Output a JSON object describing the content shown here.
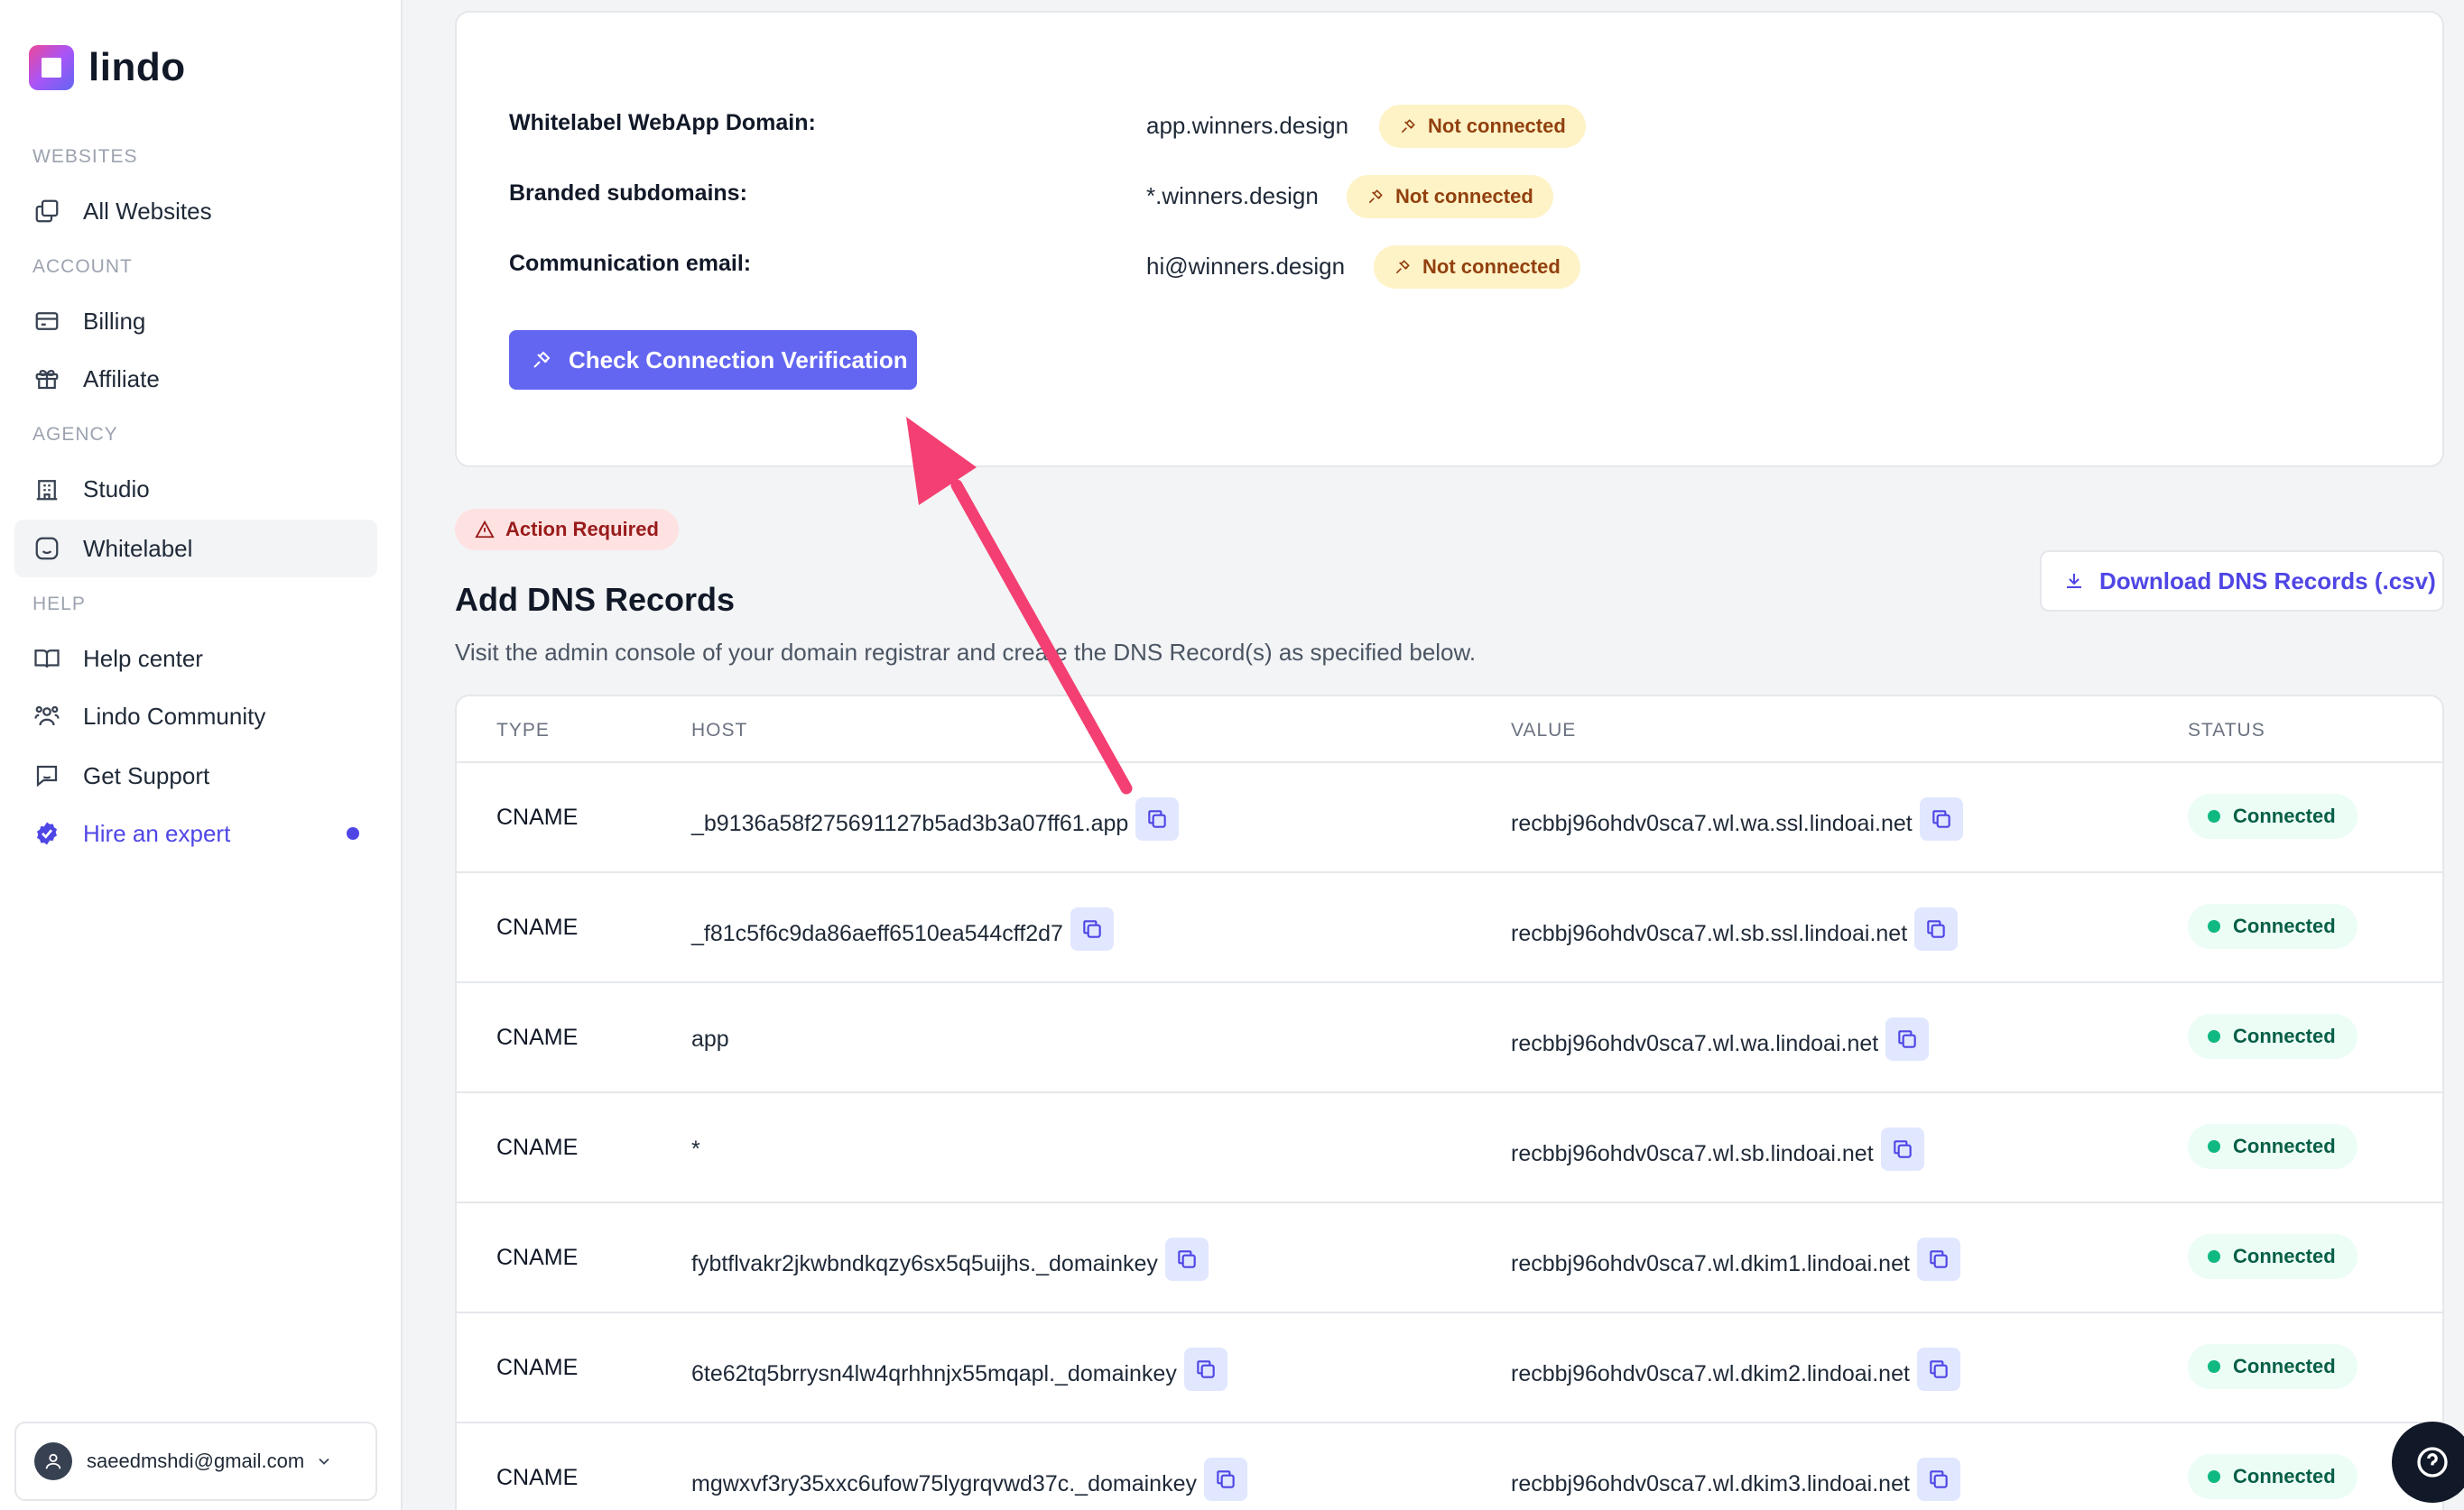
{
  "app": {
    "name": "lindo"
  },
  "sidebar": {
    "sections": [
      "WEBSITES",
      "ACCOUNT",
      "AGENCY",
      "HELP"
    ],
    "items": [
      {
        "label": "All Websites",
        "icon": "websites-icon"
      },
      {
        "label": "Billing",
        "icon": "credit-card-icon"
      },
      {
        "label": "Affiliate",
        "icon": "gift-icon"
      },
      {
        "label": "Studio",
        "icon": "building-icon"
      },
      {
        "label": "Whitelabel",
        "icon": "smiley-icon",
        "active": true
      },
      {
        "label": "Help center",
        "icon": "book-icon"
      },
      {
        "label": "Lindo Community",
        "icon": "community-icon"
      },
      {
        "label": "Get Support",
        "icon": "chat-support-icon"
      },
      {
        "label": "Hire an expert",
        "icon": "verified-badge-icon"
      }
    ],
    "user": {
      "email": "saeedmshdi@gmail.com"
    }
  },
  "domains": {
    "rows": [
      {
        "label": "Whitelabel WebApp Domain:",
        "value": "app.winners.design",
        "status": "Not connected"
      },
      {
        "label": "Branded subdomains:",
        "value": "*.winners.design",
        "status": "Not connected"
      },
      {
        "label": "Communication email:",
        "value": "hi@winners.design",
        "status": "Not connected"
      }
    ],
    "check_button": "Check Connection Verification"
  },
  "dns": {
    "action_badge": "Action Required",
    "title": "Add DNS Records",
    "description": "Visit the admin console of your domain registrar and create the DNS Record(s) as specified below.",
    "download_button": "Download DNS Records (.csv)",
    "columns": [
      "TYPE",
      "HOST",
      "VALUE",
      "STATUS"
    ],
    "records": [
      {
        "type": "CNAME",
        "host": "_b9136a58f275691127b5ad3b3a07ff61.app",
        "value": "recbbj96ohdv0sca7.wl.wa.ssl.lindoai.net",
        "status": "Connected",
        "host_copy": true
      },
      {
        "type": "CNAME",
        "host": "_f81c5f6c9da86aeff6510ea544cff2d7",
        "value": "recbbj96ohdv0sca7.wl.sb.ssl.lindoai.net",
        "status": "Connected",
        "host_copy": true
      },
      {
        "type": "CNAME",
        "host": "app",
        "value": "recbbj96ohdv0sca7.wl.wa.lindoai.net",
        "status": "Connected",
        "host_copy": false
      },
      {
        "type": "CNAME",
        "host": "*",
        "value": "recbbj96ohdv0sca7.wl.sb.lindoai.net",
        "status": "Connected",
        "host_copy": false
      },
      {
        "type": "CNAME",
        "host": "fybtflvakr2jkwbndkqzy6sx5q5uijhs._domainkey",
        "value": "recbbj96ohdv0sca7.wl.dkim1.lindoai.net",
        "status": "Connected",
        "host_copy": true
      },
      {
        "type": "CNAME",
        "host": "6te62tq5brrysn4lw4qrhhnjx55mqapl._domainkey",
        "value": "recbbj96ohdv0sca7.wl.dkim2.lindoai.net",
        "status": "Connected",
        "host_copy": true
      },
      {
        "type": "CNAME",
        "host": "mgwxvf3ry35xxc6ufow75lygrqvwd37c._domainkey",
        "value": "recbbj96ohdv0sca7.wl.dkim3.lindoai.net",
        "status": "Connected",
        "host_copy": true
      }
    ]
  },
  "colors": {
    "accent": "#6366f1",
    "annotation_arrow": "#f43f72",
    "warning_bg": "#fef3c7",
    "success_bg": "#ecfdf5"
  }
}
